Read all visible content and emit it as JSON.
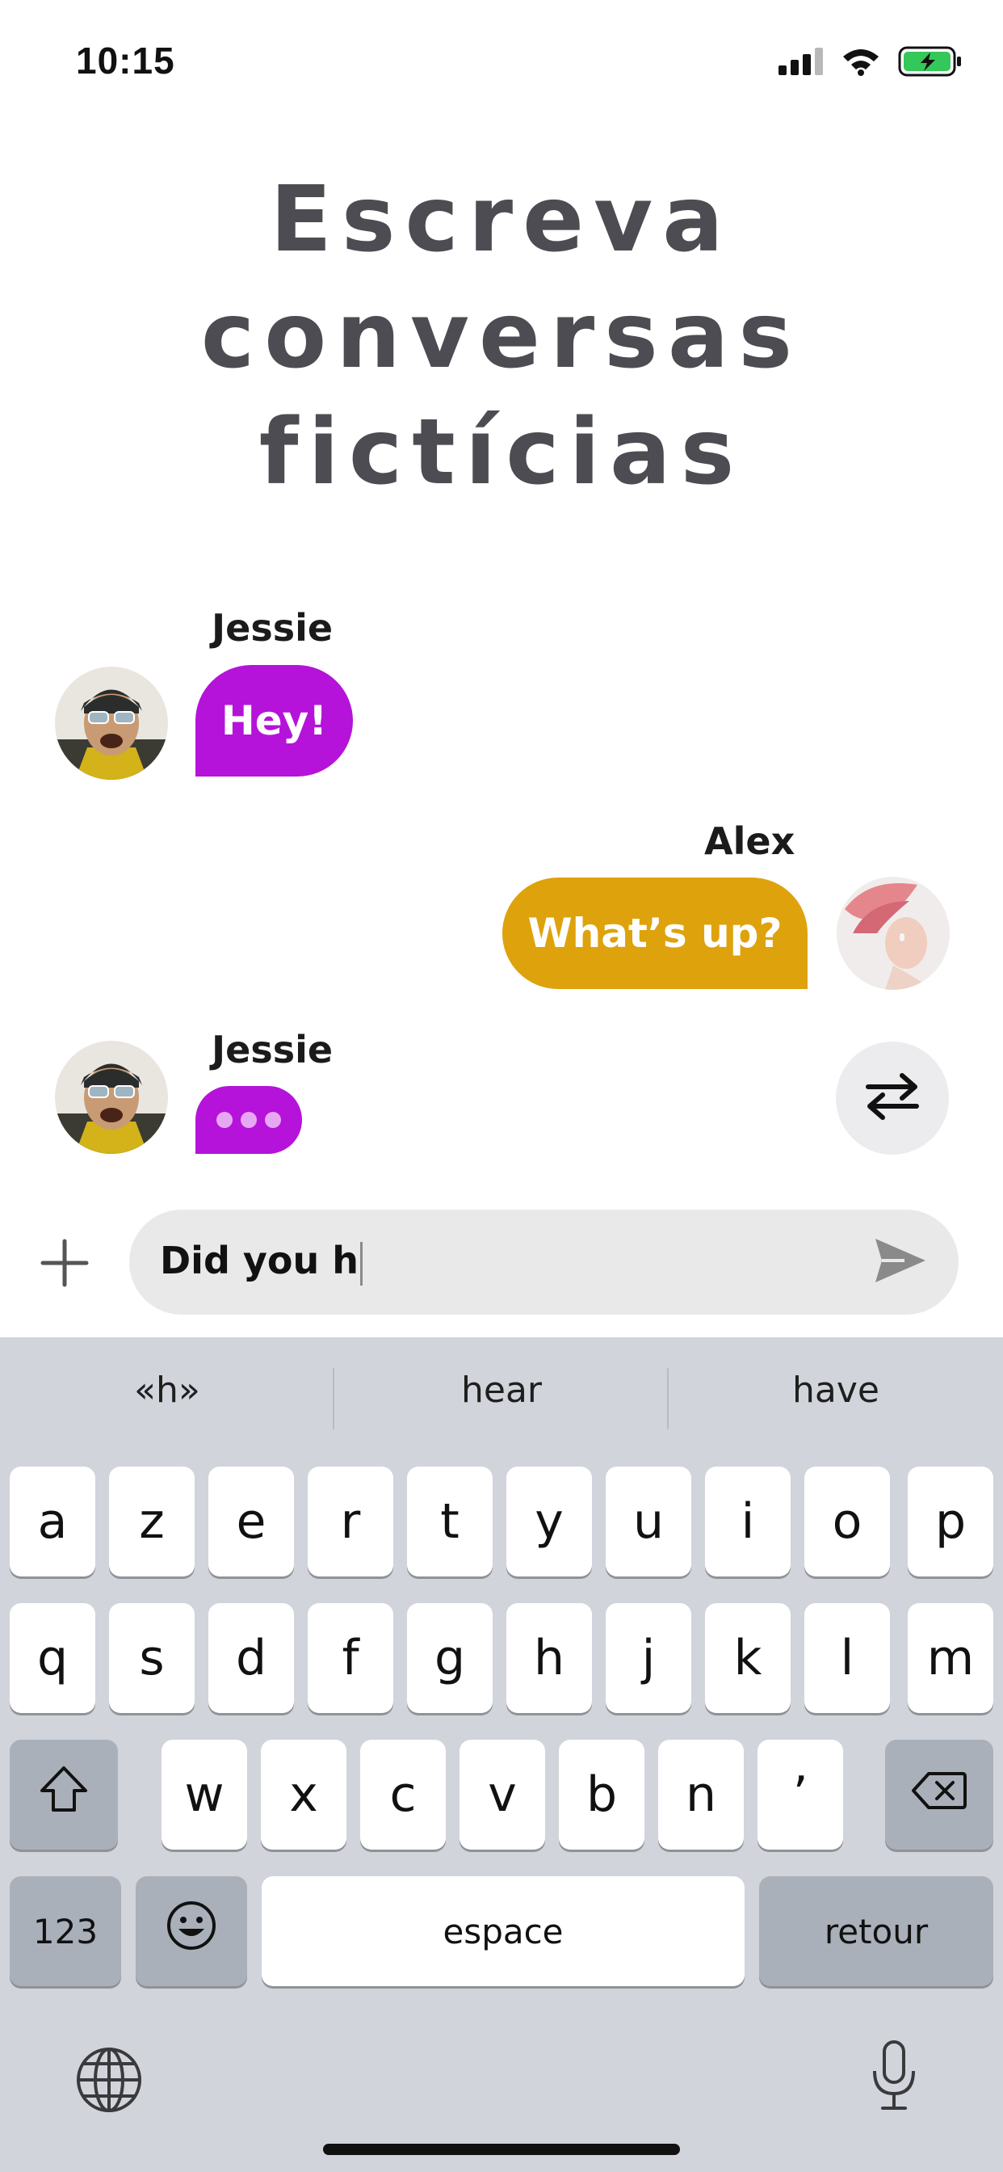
{
  "status_bar": {
    "time": "10:15",
    "icons": [
      "signal-icon",
      "wifi-icon",
      "battery-charging-icon"
    ],
    "battery_color": "#34c759"
  },
  "title": {
    "lines": [
      "Escreva",
      "conversas",
      "fictícias"
    ]
  },
  "messages": [
    {
      "sender": "Jessie",
      "text": "Hey!",
      "side": "left",
      "color": "#b513d9"
    },
    {
      "sender": "Alex",
      "text": "What’s up?",
      "side": "right",
      "color": "#dea20c"
    },
    {
      "sender": "Jessie",
      "typing": true,
      "side": "left",
      "color": "#b513d9"
    }
  ],
  "controls": {
    "swap_icon": "swap-arrows-icon",
    "plus_icon": "plus-icon",
    "send_icon": "send-icon"
  },
  "composer": {
    "value": "Did you h"
  },
  "keyboard": {
    "suggestions": [
      "«h»",
      "hear",
      "have"
    ],
    "row1": [
      "a",
      "z",
      "e",
      "r",
      "t",
      "y",
      "u",
      "i",
      "o",
      "p"
    ],
    "row2": [
      "q",
      "s",
      "d",
      "f",
      "g",
      "h",
      "j",
      "k",
      "l",
      "m"
    ],
    "row3": [
      "w",
      "x",
      "c",
      "v",
      "b",
      "n",
      "’"
    ],
    "numbers_key": "123",
    "space_key": "espace",
    "return_key": "retour",
    "icons": [
      "shift-icon",
      "backspace-icon",
      "emoji-icon",
      "globe-icon",
      "microphone-icon"
    ]
  }
}
